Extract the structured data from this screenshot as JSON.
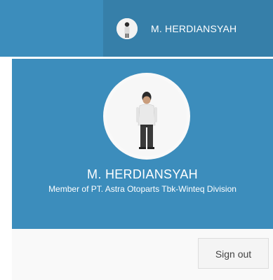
{
  "navbar": {
    "user_name": "M. HERDIANSYAH",
    "avatar_icon": "user-avatar-photo"
  },
  "user_dropdown": {
    "header": {
      "name": "M. HERDIANSYAH",
      "description": "Member of PT. Astra Otoparts Tbk-Winteq Division",
      "avatar_icon": "user-avatar-photo"
    },
    "footer": {
      "signout_label": "Sign out"
    }
  },
  "colors": {
    "header_blue": "#3c8dbc",
    "toggle_blue": "#367fa9",
    "footer_bg": "#f9f9f9",
    "button_bg": "#f4f4f4"
  }
}
